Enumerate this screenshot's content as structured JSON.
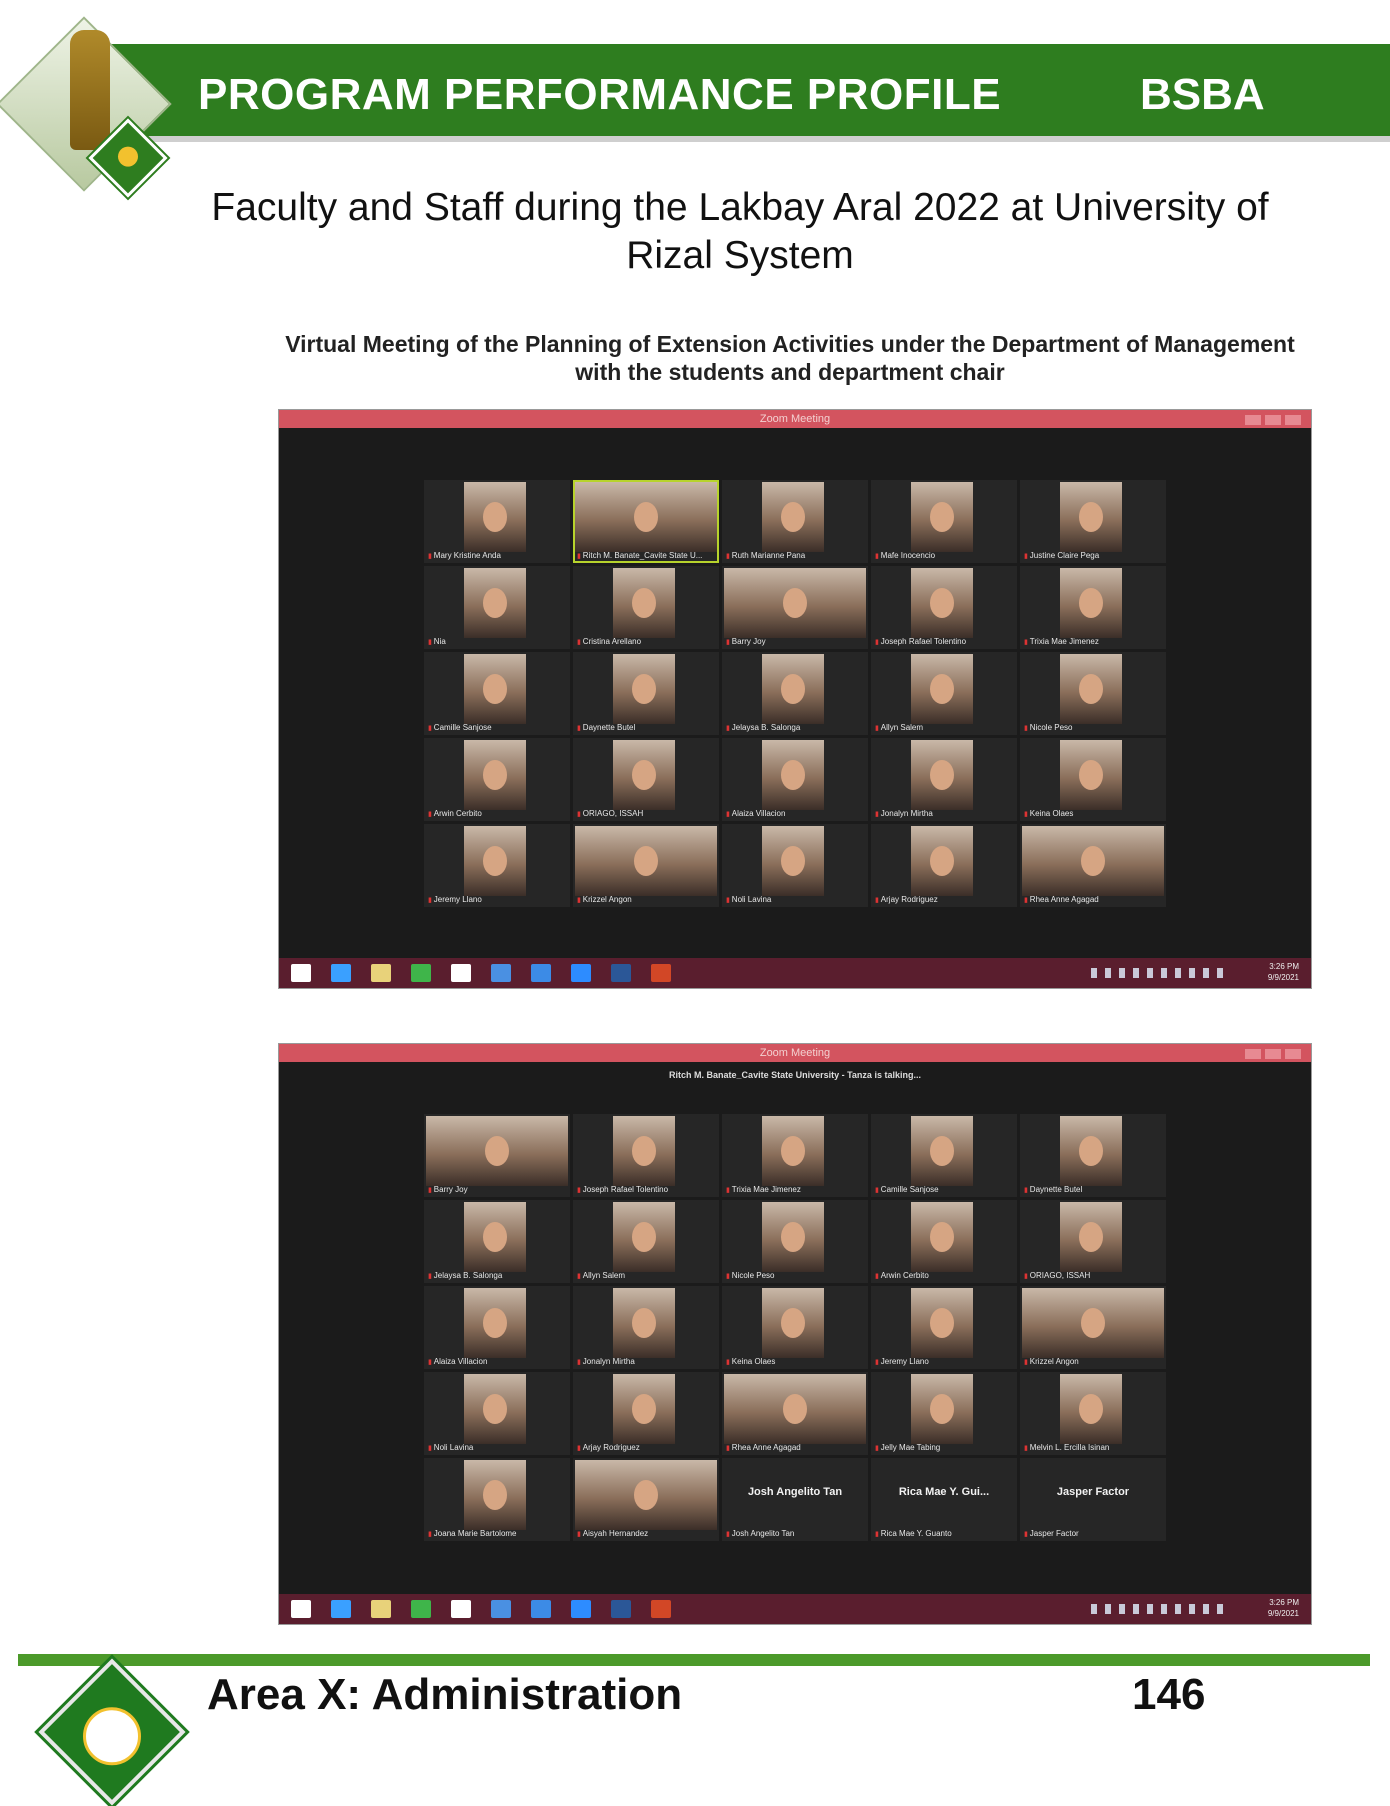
{
  "header": {
    "title": "PROGRAM PERFORMANCE PROFILE",
    "program": "BSBA"
  },
  "caption": {
    "line1": "Faculty and Staff during the Lakbay Aral 2022 at University of",
    "line2": "Rizal System"
  },
  "subcaption": {
    "line1": "Virtual Meeting of the Planning of Extension Activities under the Department of Management",
    "line2": "with the students and department chair"
  },
  "screenshot1": {
    "window_title": "Zoom Meeting",
    "clock_time": "3:26 PM",
    "clock_date": "9/9/2021",
    "participants": [
      "Mary Kristine Anda",
      "Ritch M. Banate_Cavite State U...",
      "Ruth Marianne Pana",
      "Mafe Inocencio",
      "Justine Claire Pega",
      "Nia",
      "Cristina Arellano",
      "Barry Joy",
      "Joseph Rafael Tolentino",
      "Trixia Mae Jimenez",
      "Camille Sanjose",
      "Daynette Butel",
      "Jelaysa B. Salonga",
      "Allyn Salem",
      "Nicole Peso",
      "Arwin Cerbito",
      "ORIAGO, ISSAH",
      "Alaiza Villacion",
      "Jonalyn Mirtha",
      "Keina Olaes",
      "Jeremy Llano",
      "Krizzel Angon",
      "Noli Lavina",
      "Arjay Rodriguez",
      "Rhea Anne Agagad"
    ]
  },
  "screenshot2": {
    "window_title": "Zoom Meeting",
    "talking": "Ritch M. Banate_Cavite State University - Tanza is talking...",
    "clock_time": "3:26 PM",
    "clock_date": "9/9/2021",
    "participants": [
      "Barry Joy",
      "Joseph Rafael Tolentino",
      "Trixia Mae Jimenez",
      "Camille Sanjose",
      "Daynette Butel",
      "Jelaysa B. Salonga",
      "Allyn Salem",
      "Nicole Peso",
      "Arwin Cerbito",
      "ORIAGO, ISSAH",
      "Alaiza Villacion",
      "Jonalyn Mirtha",
      "Keina Olaes",
      "Jeremy Llano",
      "Krizzel Angon",
      "Noli Lavina",
      "Arjay Rodriguez",
      "Rhea Anne Agagad",
      "Jelly Mae Tabing",
      "Melvin L. Ercilla Isinan",
      "Joana Marie Bartolome",
      "Aisyah Hernandez",
      "Josh Angelito Tan",
      "Rica Mae Y. Guanto",
      "Jasper Factor"
    ],
    "no_video": [
      {
        "display": "Josh Angelito Tan"
      },
      {
        "display": "Rica Mae Y. Gui..."
      },
      {
        "display": "Jasper Factor"
      }
    ]
  },
  "footer": {
    "area": "Area X: Administration",
    "page": "146"
  }
}
